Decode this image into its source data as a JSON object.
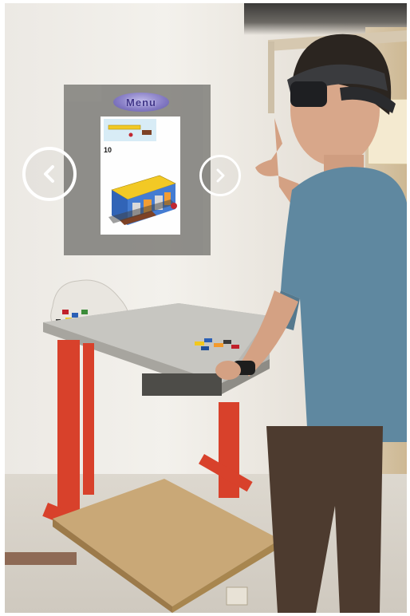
{
  "hologram": {
    "menu_label": "Menu",
    "step_number": "10"
  },
  "colors": {
    "panel": "#8b8a86",
    "menu_pill": "#7f75c2",
    "table_frame": "#d8412b",
    "shirt": "#5f88a0"
  },
  "icons": {
    "prev": "chevron-left-icon",
    "next": "chevron-right-icon"
  }
}
